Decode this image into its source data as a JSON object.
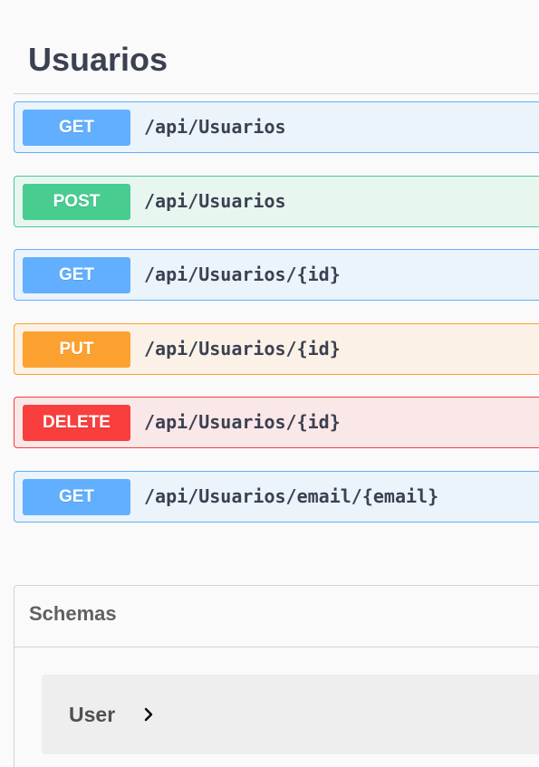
{
  "tag": {
    "title": "Usuarios"
  },
  "operations": [
    {
      "method": "GET",
      "path": "/api/Usuarios",
      "color": "#61affe"
    },
    {
      "method": "POST",
      "path": "/api/Usuarios",
      "color": "#49cc90"
    },
    {
      "method": "GET",
      "path": "/api/Usuarios/{id}",
      "color": "#61affe"
    },
    {
      "method": "PUT",
      "path": "/api/Usuarios/{id}",
      "color": "#fca130"
    },
    {
      "method": "DELETE",
      "path": "/api/Usuarios/{id}",
      "color": "#f93e3e"
    },
    {
      "method": "GET",
      "path": "/api/Usuarios/email/{email}",
      "color": "#61affe"
    }
  ],
  "schemas": {
    "title": "Schemas",
    "models": [
      {
        "name": "User",
        "icon": "chevron-right-icon"
      }
    ]
  }
}
